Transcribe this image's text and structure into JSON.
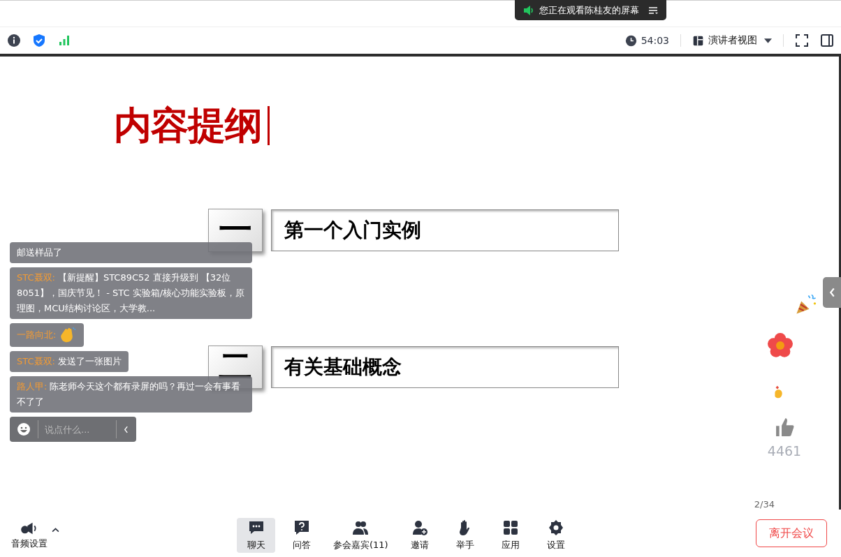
{
  "top_banner": {
    "text": "您正在观看陈桂友的屏幕"
  },
  "toolbar": {
    "timer": "54:03",
    "view_label": "演讲者视图"
  },
  "slide": {
    "title": "内容提纲",
    "items": [
      {
        "numeral": "一",
        "text": "第一个入门实例"
      },
      {
        "numeral": "二",
        "text": "有关基础概念"
      }
    ],
    "page": "2/34"
  },
  "chat": {
    "messages": [
      {
        "kind": "text",
        "text": "邮送样品了"
      },
      {
        "kind": "text",
        "sender": "STC聂双:",
        "text": "【新提醒】STC89C52 直接升级到 【32位8051】，国庆节见！ - STC 实验箱/核心功能实验板，原理图，MCU结构讨论区，大学教..."
      },
      {
        "kind": "emoji",
        "sender": "一路向北:"
      },
      {
        "kind": "text",
        "sender": "STC聂双:",
        "text": "发送了一张图片"
      },
      {
        "kind": "text",
        "sender": "路人甲:",
        "text": "陈老师今天这个都有录屏的吗？再过一会有事看不了了"
      }
    ],
    "placeholder": "说点什么..."
  },
  "likes": "4461",
  "bottom": {
    "audio_label": "音频设置",
    "tools": [
      {
        "kind": "chat",
        "label": "聊天",
        "selected": true
      },
      {
        "kind": "qa",
        "label": "问答",
        "selected": false
      },
      {
        "kind": "people",
        "label": "参会嘉宾(11)",
        "selected": false
      },
      {
        "kind": "invite",
        "label": "邀请",
        "selected": false
      },
      {
        "kind": "hand",
        "label": "举手",
        "selected": false
      },
      {
        "kind": "apps",
        "label": "应用",
        "selected": false
      },
      {
        "kind": "settings",
        "label": "设置",
        "selected": false
      }
    ],
    "leave_button": "离开会议"
  }
}
